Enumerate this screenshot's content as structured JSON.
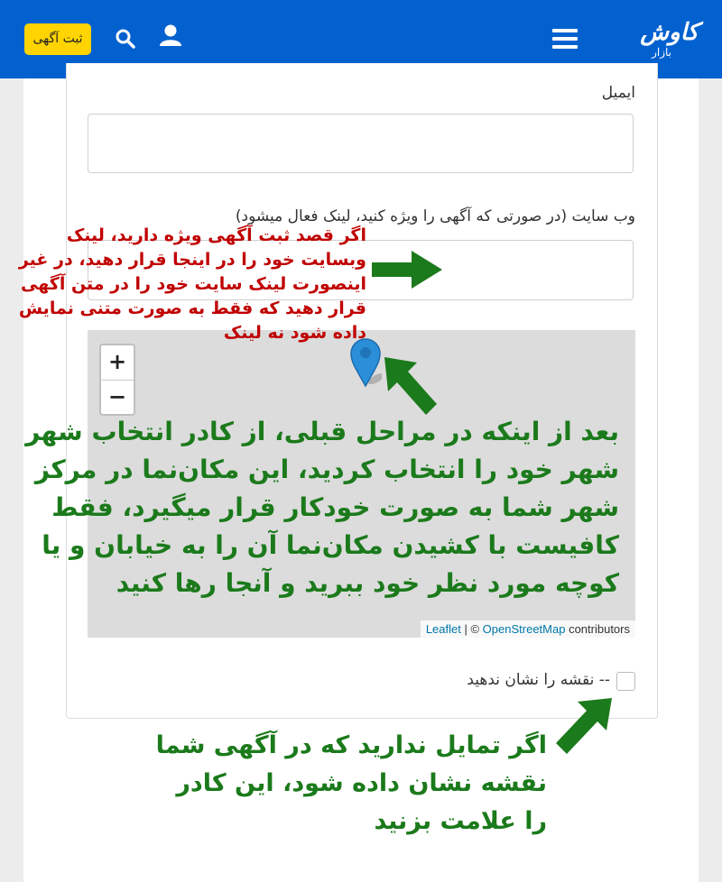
{
  "header": {
    "logo_main": "کاوش",
    "logo_sub": "بازار",
    "post_ad_label": "ثبت آگهی",
    "icons": [
      "menu-icon",
      "search-icon",
      "user-icon"
    ]
  },
  "form": {
    "email_label": "ایمیل",
    "website_label": "وب سایت (در صورتی که آگهی را ویژه کنید، لینک فعال میشود)",
    "hide_map_label": "-- نقشه را نشان ندهید"
  },
  "map": {
    "zoom_in": "+",
    "zoom_out": "−",
    "attrib_leaflet": "Leaflet",
    "attrib_sep": " | © ",
    "attrib_osm": "OpenStreetMap",
    "attrib_suffix": " contributors"
  },
  "annotations": {
    "red": "اگر قصد ثبت آگهی ویژه دارید، لینک وبسایت خود را در اینجا قرار دهید، در غیر اینصورت لینک سایت خود را در متن آگهی قرار دهید که فقط به صورت متنی نمایش داده شود نه لینک",
    "map_help": "بعد از اینکه در مراحل قبلی، از کادر انتخاب شهر شهر خود را انتخاب کردید، این مکان‌نما در مرکز شهر شما به صورت خودکار قرار میگیرد، فقط کافیست با کشیدن مکان‌نما آن را به خیابان و یا کوچه مورد نظر خود ببرید و آنجا رها کنید",
    "checkbox_help": "اگر تمایل ندارید که در آگهی شما نقشه نشان داده شود، این کادر را علامت بزنید"
  },
  "colors": {
    "header": "#0361cf",
    "post_button": "#ffd400",
    "annotation_red": "#c00000",
    "annotation_green": "#1b7a1b"
  }
}
